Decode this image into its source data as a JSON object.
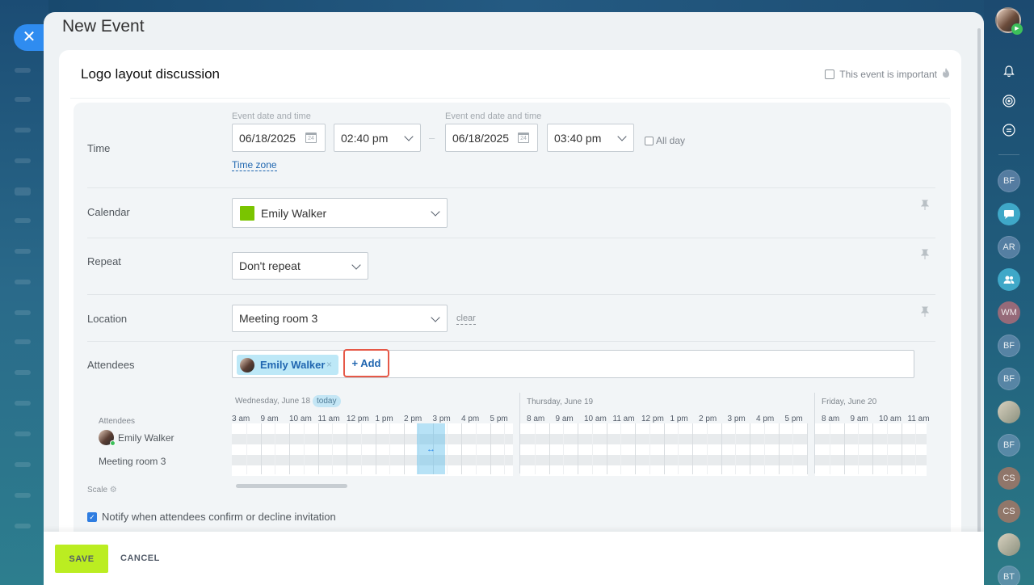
{
  "panel": {
    "title": "New Event",
    "event_name": "Logo layout discussion",
    "important_label": "This event is important"
  },
  "time": {
    "row_label": "Time",
    "start_label": "Event date and time",
    "start_date": "06/18/2025",
    "start_time": "02:40 pm",
    "end_label": "Event end date and time",
    "end_date": "06/18/2025",
    "end_time": "03:40 pm",
    "all_day_label": "All day",
    "timezone_link": "Time zone",
    "calendar_icon_text": "24"
  },
  "calendar": {
    "row_label": "Calendar",
    "value": "Emily Walker",
    "color": "#7ac400"
  },
  "repeat": {
    "row_label": "Repeat",
    "value": "Don't repeat"
  },
  "location": {
    "row_label": "Location",
    "value": "Meeting room 3",
    "clear_label": "clear"
  },
  "attendees": {
    "row_label": "Attendees",
    "chips": [
      {
        "name": "Emily Walker",
        "remove": "×"
      }
    ],
    "add_label": "+ Add"
  },
  "planner": {
    "days": [
      {
        "label": "Wednesday, June 18",
        "today": "today",
        "hours": [
          "3 am",
          "9 am",
          "10 am",
          "11 am",
          "12 pm",
          "1 pm",
          "2 pm",
          "3 pm",
          "4 pm",
          "5 pm"
        ]
      },
      {
        "label": "Thursday, June 19",
        "hours": [
          "8 am",
          "9 am",
          "10 am",
          "11 am",
          "12 pm",
          "1 pm",
          "2 pm",
          "3 pm",
          "4 pm",
          "5 pm"
        ]
      },
      {
        "label": "Friday, June 20",
        "hours": [
          "8 am",
          "9 am",
          "10 am",
          "11 am"
        ]
      }
    ],
    "attendees_heading": "Attendees",
    "rows": [
      "Emily Walker",
      "Meeting room 3"
    ],
    "scale_label": "Scale",
    "selection_handle": "↔"
  },
  "notify": {
    "label": "Notify when attendees confirm or decline invitation",
    "checked": true
  },
  "footer": {
    "save_label": "SAVE",
    "cancel_label": "CANCEL"
  },
  "right_sidebar": {
    "items": [
      {
        "type": "icon",
        "icon": "bell-icon"
      },
      {
        "type": "icon",
        "icon": "spiral-icon"
      },
      {
        "type": "icon",
        "icon": "chat-refresh-icon"
      },
      {
        "type": "initials",
        "text": "BF"
      },
      {
        "type": "icon",
        "icon": "chat-bubble-icon"
      },
      {
        "type": "initials",
        "text": "AR"
      },
      {
        "type": "icon",
        "icon": "group-icon"
      },
      {
        "type": "initials",
        "text": "WM"
      },
      {
        "type": "initials",
        "text": "BF"
      },
      {
        "type": "initials",
        "text": "BF"
      },
      {
        "type": "photo"
      },
      {
        "type": "initials",
        "text": "BF"
      },
      {
        "type": "initials",
        "text": "CS"
      },
      {
        "type": "initials",
        "text": "CS"
      },
      {
        "type": "photo"
      },
      {
        "type": "initials",
        "text": "BT"
      }
    ]
  }
}
